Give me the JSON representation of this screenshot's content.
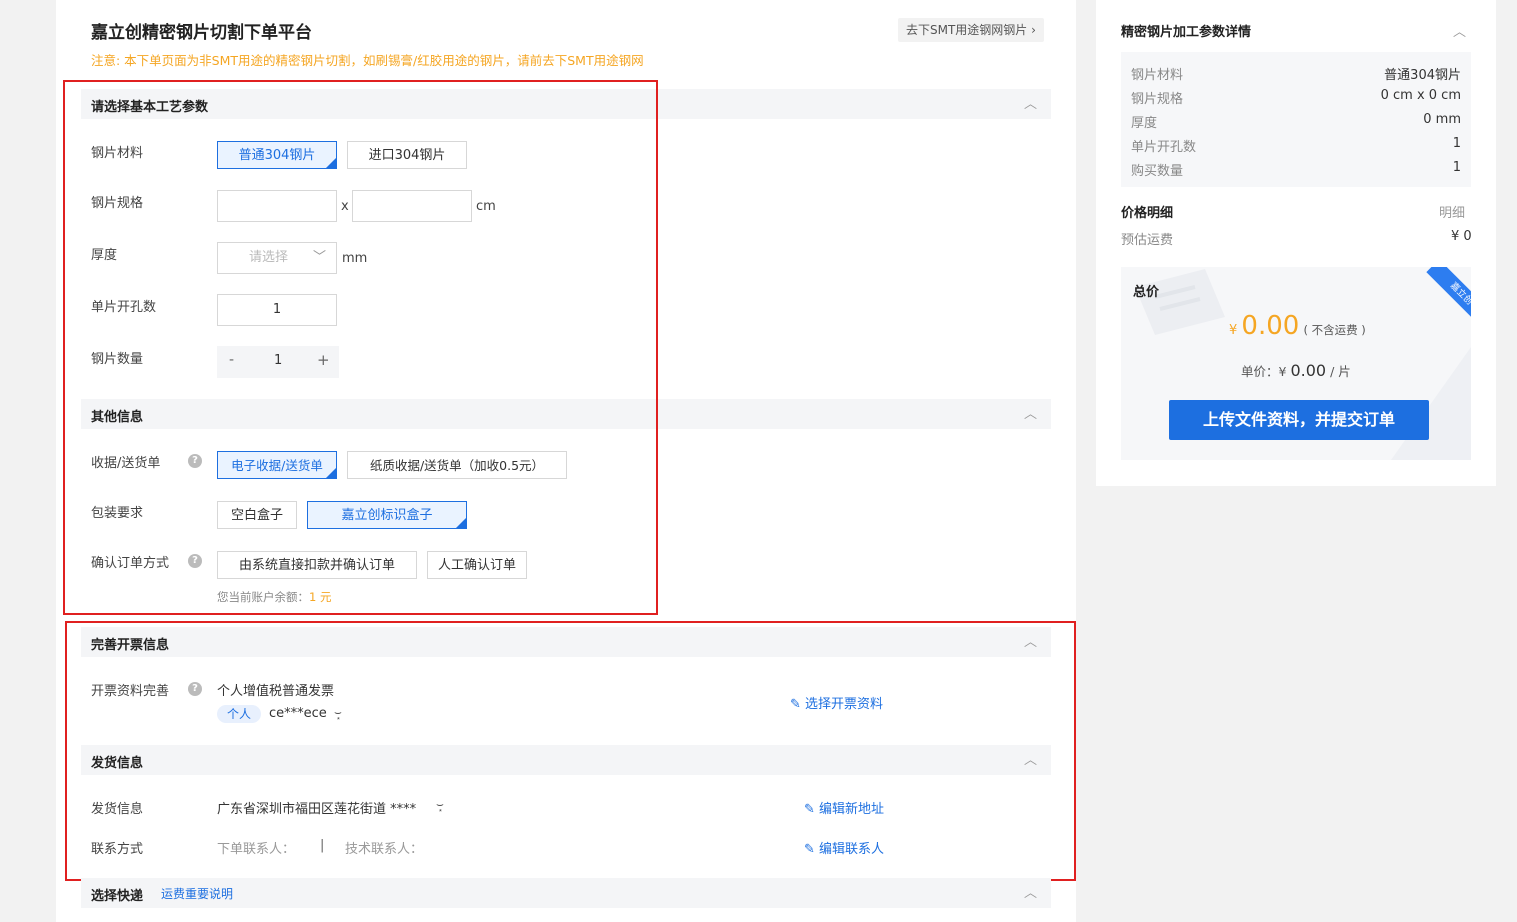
{
  "header": {
    "title": "嘉立创精密钢片切割下单平台",
    "goto_button": "去下SMT用途钢网钢片",
    "notice": "注意: 本下单页面为非SMT用途的精密钢片切割，如刷锡膏/红胶用途的钢片，请前去下SMT用途钢网"
  },
  "basic": {
    "section_title": "请选择基本工艺参数",
    "material_label": "钢片材料",
    "material_options": [
      "普通304钢片",
      "进口304钢片"
    ],
    "material_selected": "普通304钢片",
    "spec_label": "钢片规格",
    "spec_x": "x",
    "spec_unit": "cm",
    "thickness_label": "厚度",
    "thickness_placeholder": "请选择",
    "thickness_unit": "mm",
    "holes_label": "单片开孔数",
    "holes_value": "1",
    "qty_label": "钢片数量",
    "qty_minus": "-",
    "qty_value": "1",
    "qty_plus": "+"
  },
  "other": {
    "section_title": "其他信息",
    "receipt_label": "收据/送货单",
    "receipt_options": [
      "电子收据/送货单",
      "纸质收据/送货单（加收0.5元）"
    ],
    "packing_label": "包装要求",
    "packing_options": [
      "空白盒子",
      "嘉立创标识盒子"
    ],
    "confirm_label": "确认订单方式",
    "confirm_options": [
      "由系统直接扣款并确认订单",
      "人工确认订单"
    ],
    "balance_text": "您当前账户余额：",
    "balance_value": "1 元"
  },
  "invoice": {
    "section_title": "完善开票信息",
    "label": "开票资料完善",
    "type": "个人增值税普通发票",
    "tag": "个人",
    "name": "ce***ece",
    "select_link": "选择开票资料"
  },
  "shipping": {
    "section_title": "发货信息",
    "address_label": "发货信息",
    "address": "广东省深圳市福田区莲花街道 ****",
    "edit_address": "编辑新地址",
    "contact_label": "联系方式",
    "order_contact": "下单联系人：",
    "separator": "|",
    "tech_contact": "技术联系人：",
    "edit_contact": "编辑联系人"
  },
  "express": {
    "section_title": "选择快递",
    "note_link": "运费重要说明"
  },
  "summary": {
    "title": "精密钢片加工参数详情",
    "params": [
      {
        "k": "钢片材料",
        "v": "普通304钢片"
      },
      {
        "k": "钢片规格",
        "v": "0 cm x 0 cm"
      },
      {
        "k": "厚度",
        "v": "0 mm"
      },
      {
        "k": "单片开孔数",
        "v": "1"
      },
      {
        "k": "购买数量",
        "v": "1"
      }
    ],
    "price_detail_label": "价格明细",
    "price_detail_link": "明细",
    "shipping_fee_label": "预估运费",
    "shipping_fee_value": "¥ 0",
    "total_label": "总价",
    "currency": "¥",
    "total_value": "0.00",
    "total_note": "( 不含运费 )",
    "unit_price_label": "单价：",
    "unit_price_currency": "¥",
    "unit_price_value": "0.00",
    "unit_price_unit": "/ 片",
    "ribbon_text": "嘉立创",
    "submit_button": "上传文件资料，并提交订单"
  }
}
